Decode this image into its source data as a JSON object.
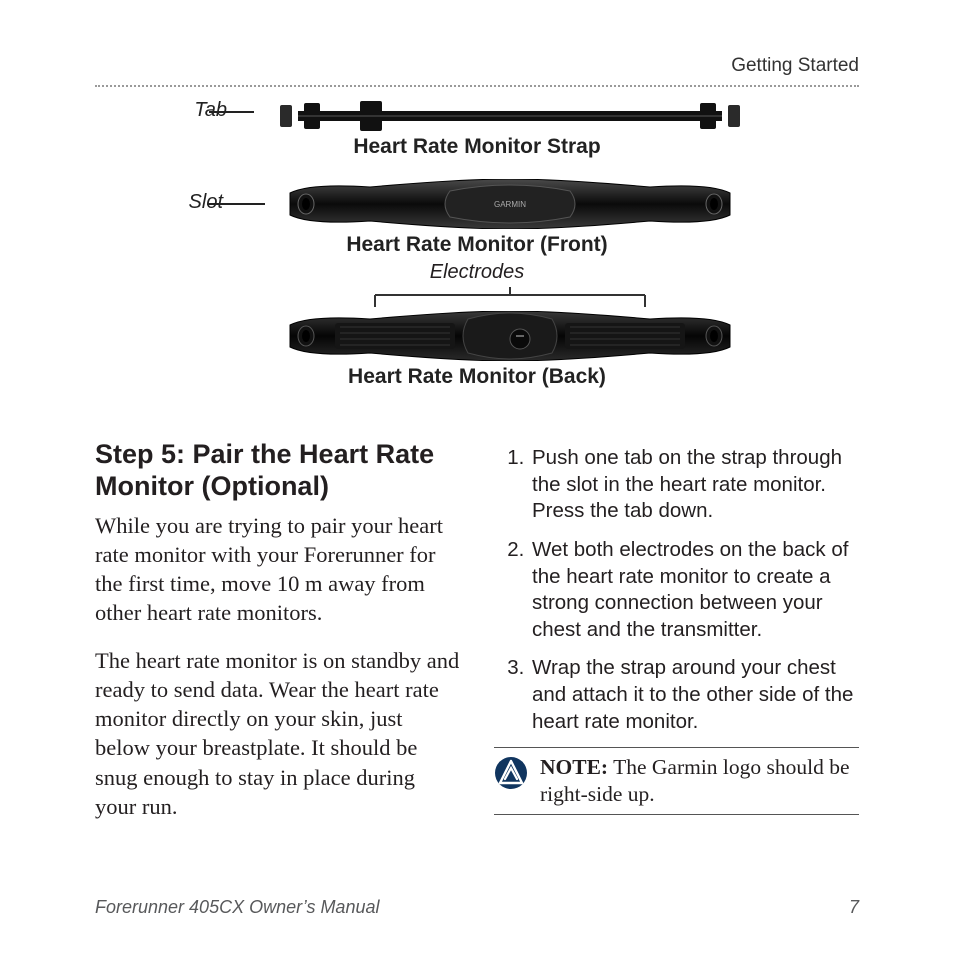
{
  "header": {
    "section": "Getting Started"
  },
  "diagram": {
    "callout_tab": "Tab",
    "callout_slot": "Slot",
    "caption_strap": "Heart Rate Monitor Strap",
    "caption_front": "Heart Rate Monitor (Front)",
    "label_electrodes": "Electrodes",
    "caption_back": "Heart Rate Monitor (Back)",
    "brand_on_front": "GARMIN"
  },
  "body": {
    "step_title": "Step 5: Pair the Heart Rate Monitor (Optional)",
    "para1": "While you are trying to pair your heart rate monitor with your Forerunner for the first time, move 10 m away from other heart rate monitors.",
    "para2": "The heart rate monitor is on standby and ready to send data. Wear the heart rate monitor directly on your skin, just below your breastplate. It should be snug enough to stay in place during your run.",
    "list": [
      "Push one tab on the strap through the slot in the heart rate monitor. Press the tab down.",
      "Wet both electrodes on the back of the heart rate monitor to create a strong connection between your chest and the transmitter.",
      "Wrap the strap around your chest and attach it to the other side of the heart rate monitor."
    ],
    "note_label": "NOTE:",
    "note_text": " The Garmin logo should be right-side up."
  },
  "footer": {
    "manual": "Forerunner 405CX Owner’s Manual",
    "page": "7"
  }
}
